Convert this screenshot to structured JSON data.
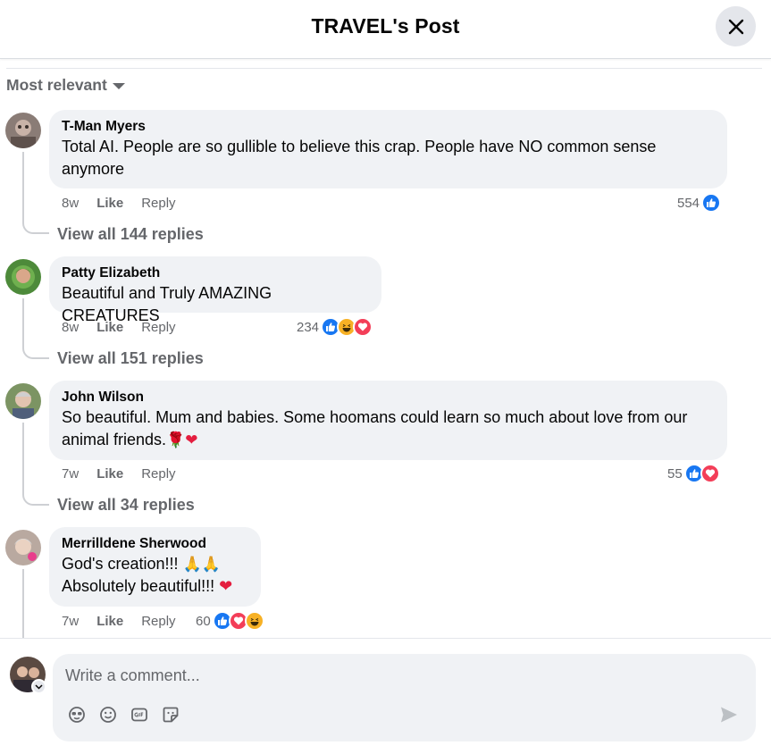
{
  "header": {
    "title": "TRAVEL's Post",
    "close_icon": "close-icon"
  },
  "sort": {
    "label": "Most relevant"
  },
  "comments": [
    {
      "author": "T-Man Myers",
      "text": "Total AI. People are so gullible to believe this crap. People have NO common sense anymore",
      "time": "8w",
      "like": "Like",
      "reply": "Reply",
      "reaction_count": "554",
      "reactions": [
        "like"
      ],
      "view_replies": "View all 144 replies"
    },
    {
      "author": "Patty Elizabeth",
      "text": "Beautiful and Truly AMAZING CREATURES",
      "time": "8w",
      "like": "Like",
      "reply": "Reply",
      "reaction_count": "234",
      "reactions": [
        "like",
        "haha",
        "love"
      ],
      "view_replies": "View all 151 replies"
    },
    {
      "author": "John Wilson",
      "text": "So beautiful. Mum and babies. Some hoomans could learn so much about love from our animal friends.",
      "text_emoji": "🌹❤",
      "time": "7w",
      "like": "Like",
      "reply": "Reply",
      "reaction_count": "55",
      "reactions": [
        "like",
        "love"
      ],
      "view_replies": "View all 34 replies"
    },
    {
      "author": "Merrilldene Sherwood",
      "text_line1": "God's creation!!!",
      "text_line1_emoji": "🙏🙏",
      "text_line2": "Absolutely beautiful!!!",
      "text_line2_emoji": "❤",
      "time": "7w",
      "like": "Like",
      "reply": "Reply",
      "reaction_count": "60",
      "reactions": [
        "like",
        "love",
        "haha"
      ]
    }
  ],
  "composer": {
    "placeholder": "Write a comment...",
    "tools": [
      "avatar-sticker-icon",
      "emoji-icon",
      "gif-icon",
      "sticker-icon"
    ],
    "send_icon": "send-icon"
  },
  "colors": {
    "like_blue": "#1877f2",
    "love_red": "#f33e58",
    "haha_yellow": "#f7b125",
    "secondary_text": "#65676b"
  }
}
